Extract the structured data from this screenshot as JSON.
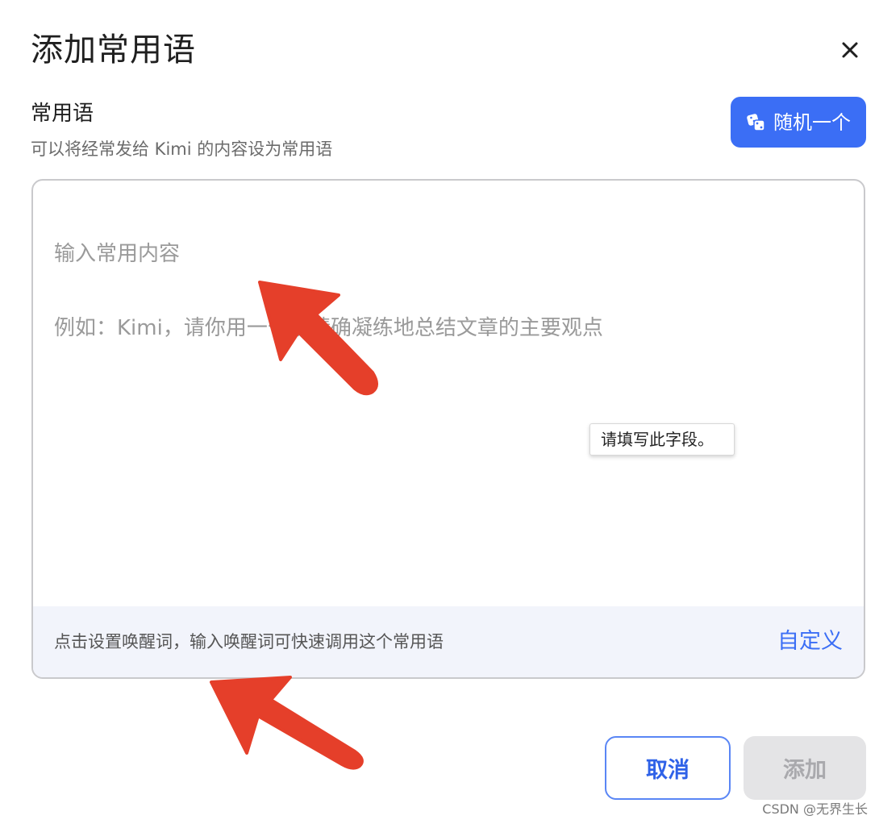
{
  "dialog": {
    "title": "添加常用语",
    "close_icon": "close-icon"
  },
  "section": {
    "label": "常用语",
    "description": "可以将经常发给 Kimi 的内容设为常用语"
  },
  "random_button": {
    "icon": "dice-icon",
    "label": "随机一个",
    "color": "#3b6ef5"
  },
  "editor": {
    "placeholder_line1": "输入常用内容",
    "placeholder_line2": "例如：Kimi，请你用一句话精确凝练地总结文章的主要观点",
    "footer_hint": "点击设置唤醒词，输入唤醒词可快速调用这个常用语",
    "customize_label": "自定义"
  },
  "validation_tooltip": {
    "text": "请填写此字段。"
  },
  "actions": {
    "cancel_label": "取消",
    "add_label": "添加",
    "add_disabled": true
  },
  "annotations": {
    "arrow_color": "#e53f2a"
  },
  "watermark": "CSDN @无界生长"
}
